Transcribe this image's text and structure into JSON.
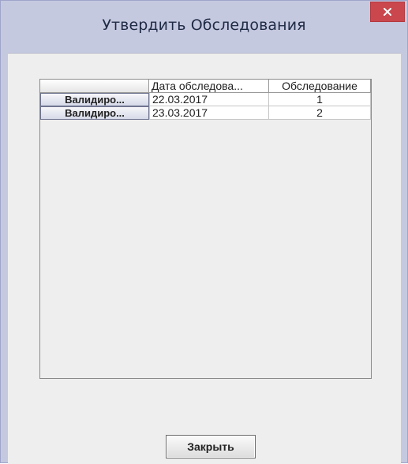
{
  "window": {
    "title": "Утвердить Обследования",
    "close_symbol": "×"
  },
  "table": {
    "columns": [
      "",
      "Дата обследова...",
      "Обследование"
    ],
    "rows": [
      {
        "action_label": "Валидиро...",
        "date": "22.03.2017",
        "number": "1"
      },
      {
        "action_label": "Валидиро...",
        "date": "23.03.2017",
        "number": "2"
      }
    ]
  },
  "footer": {
    "close_label": "Закрыть"
  },
  "colors": {
    "title_bar": "#c5c9e0",
    "close_button": "#c9474d",
    "content_bg": "#eeeeee"
  }
}
